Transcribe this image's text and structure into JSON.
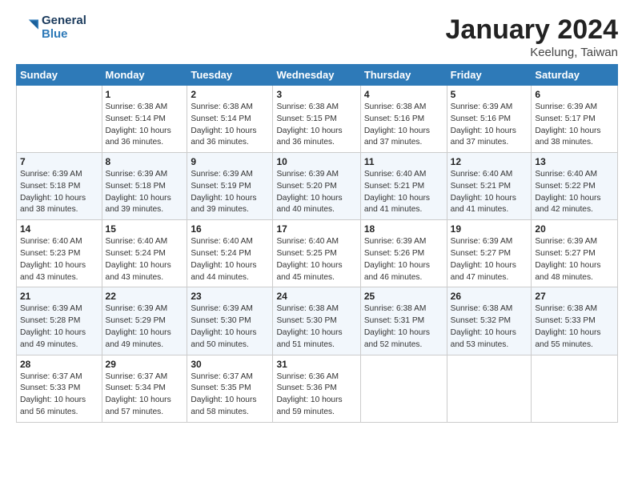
{
  "header": {
    "logo_line1": "General",
    "logo_line2": "Blue",
    "title": "January 2024",
    "subtitle": "Keelung, Taiwan"
  },
  "weekdays": [
    "Sunday",
    "Monday",
    "Tuesday",
    "Wednesday",
    "Thursday",
    "Friday",
    "Saturday"
  ],
  "weeks": [
    [
      {
        "day": "",
        "info": ""
      },
      {
        "day": "1",
        "info": "Sunrise: 6:38 AM\nSunset: 5:14 PM\nDaylight: 10 hours\nand 36 minutes."
      },
      {
        "day": "2",
        "info": "Sunrise: 6:38 AM\nSunset: 5:14 PM\nDaylight: 10 hours\nand 36 minutes."
      },
      {
        "day": "3",
        "info": "Sunrise: 6:38 AM\nSunset: 5:15 PM\nDaylight: 10 hours\nand 36 minutes."
      },
      {
        "day": "4",
        "info": "Sunrise: 6:38 AM\nSunset: 5:16 PM\nDaylight: 10 hours\nand 37 minutes."
      },
      {
        "day": "5",
        "info": "Sunrise: 6:39 AM\nSunset: 5:16 PM\nDaylight: 10 hours\nand 37 minutes."
      },
      {
        "day": "6",
        "info": "Sunrise: 6:39 AM\nSunset: 5:17 PM\nDaylight: 10 hours\nand 38 minutes."
      }
    ],
    [
      {
        "day": "7",
        "info": "Sunrise: 6:39 AM\nSunset: 5:18 PM\nDaylight: 10 hours\nand 38 minutes."
      },
      {
        "day": "8",
        "info": "Sunrise: 6:39 AM\nSunset: 5:18 PM\nDaylight: 10 hours\nand 39 minutes."
      },
      {
        "day": "9",
        "info": "Sunrise: 6:39 AM\nSunset: 5:19 PM\nDaylight: 10 hours\nand 39 minutes."
      },
      {
        "day": "10",
        "info": "Sunrise: 6:39 AM\nSunset: 5:20 PM\nDaylight: 10 hours\nand 40 minutes."
      },
      {
        "day": "11",
        "info": "Sunrise: 6:40 AM\nSunset: 5:21 PM\nDaylight: 10 hours\nand 41 minutes."
      },
      {
        "day": "12",
        "info": "Sunrise: 6:40 AM\nSunset: 5:21 PM\nDaylight: 10 hours\nand 41 minutes."
      },
      {
        "day": "13",
        "info": "Sunrise: 6:40 AM\nSunset: 5:22 PM\nDaylight: 10 hours\nand 42 minutes."
      }
    ],
    [
      {
        "day": "14",
        "info": "Sunrise: 6:40 AM\nSunset: 5:23 PM\nDaylight: 10 hours\nand 43 minutes."
      },
      {
        "day": "15",
        "info": "Sunrise: 6:40 AM\nSunset: 5:24 PM\nDaylight: 10 hours\nand 43 minutes."
      },
      {
        "day": "16",
        "info": "Sunrise: 6:40 AM\nSunset: 5:24 PM\nDaylight: 10 hours\nand 44 minutes."
      },
      {
        "day": "17",
        "info": "Sunrise: 6:40 AM\nSunset: 5:25 PM\nDaylight: 10 hours\nand 45 minutes."
      },
      {
        "day": "18",
        "info": "Sunrise: 6:39 AM\nSunset: 5:26 PM\nDaylight: 10 hours\nand 46 minutes."
      },
      {
        "day": "19",
        "info": "Sunrise: 6:39 AM\nSunset: 5:27 PM\nDaylight: 10 hours\nand 47 minutes."
      },
      {
        "day": "20",
        "info": "Sunrise: 6:39 AM\nSunset: 5:27 PM\nDaylight: 10 hours\nand 48 minutes."
      }
    ],
    [
      {
        "day": "21",
        "info": "Sunrise: 6:39 AM\nSunset: 5:28 PM\nDaylight: 10 hours\nand 49 minutes."
      },
      {
        "day": "22",
        "info": "Sunrise: 6:39 AM\nSunset: 5:29 PM\nDaylight: 10 hours\nand 49 minutes."
      },
      {
        "day": "23",
        "info": "Sunrise: 6:39 AM\nSunset: 5:30 PM\nDaylight: 10 hours\nand 50 minutes."
      },
      {
        "day": "24",
        "info": "Sunrise: 6:38 AM\nSunset: 5:30 PM\nDaylight: 10 hours\nand 51 minutes."
      },
      {
        "day": "25",
        "info": "Sunrise: 6:38 AM\nSunset: 5:31 PM\nDaylight: 10 hours\nand 52 minutes."
      },
      {
        "day": "26",
        "info": "Sunrise: 6:38 AM\nSunset: 5:32 PM\nDaylight: 10 hours\nand 53 minutes."
      },
      {
        "day": "27",
        "info": "Sunrise: 6:38 AM\nSunset: 5:33 PM\nDaylight: 10 hours\nand 55 minutes."
      }
    ],
    [
      {
        "day": "28",
        "info": "Sunrise: 6:37 AM\nSunset: 5:33 PM\nDaylight: 10 hours\nand 56 minutes."
      },
      {
        "day": "29",
        "info": "Sunrise: 6:37 AM\nSunset: 5:34 PM\nDaylight: 10 hours\nand 57 minutes."
      },
      {
        "day": "30",
        "info": "Sunrise: 6:37 AM\nSunset: 5:35 PM\nDaylight: 10 hours\nand 58 minutes."
      },
      {
        "day": "31",
        "info": "Sunrise: 6:36 AM\nSunset: 5:36 PM\nDaylight: 10 hours\nand 59 minutes."
      },
      {
        "day": "",
        "info": ""
      },
      {
        "day": "",
        "info": ""
      },
      {
        "day": "",
        "info": ""
      }
    ]
  ]
}
